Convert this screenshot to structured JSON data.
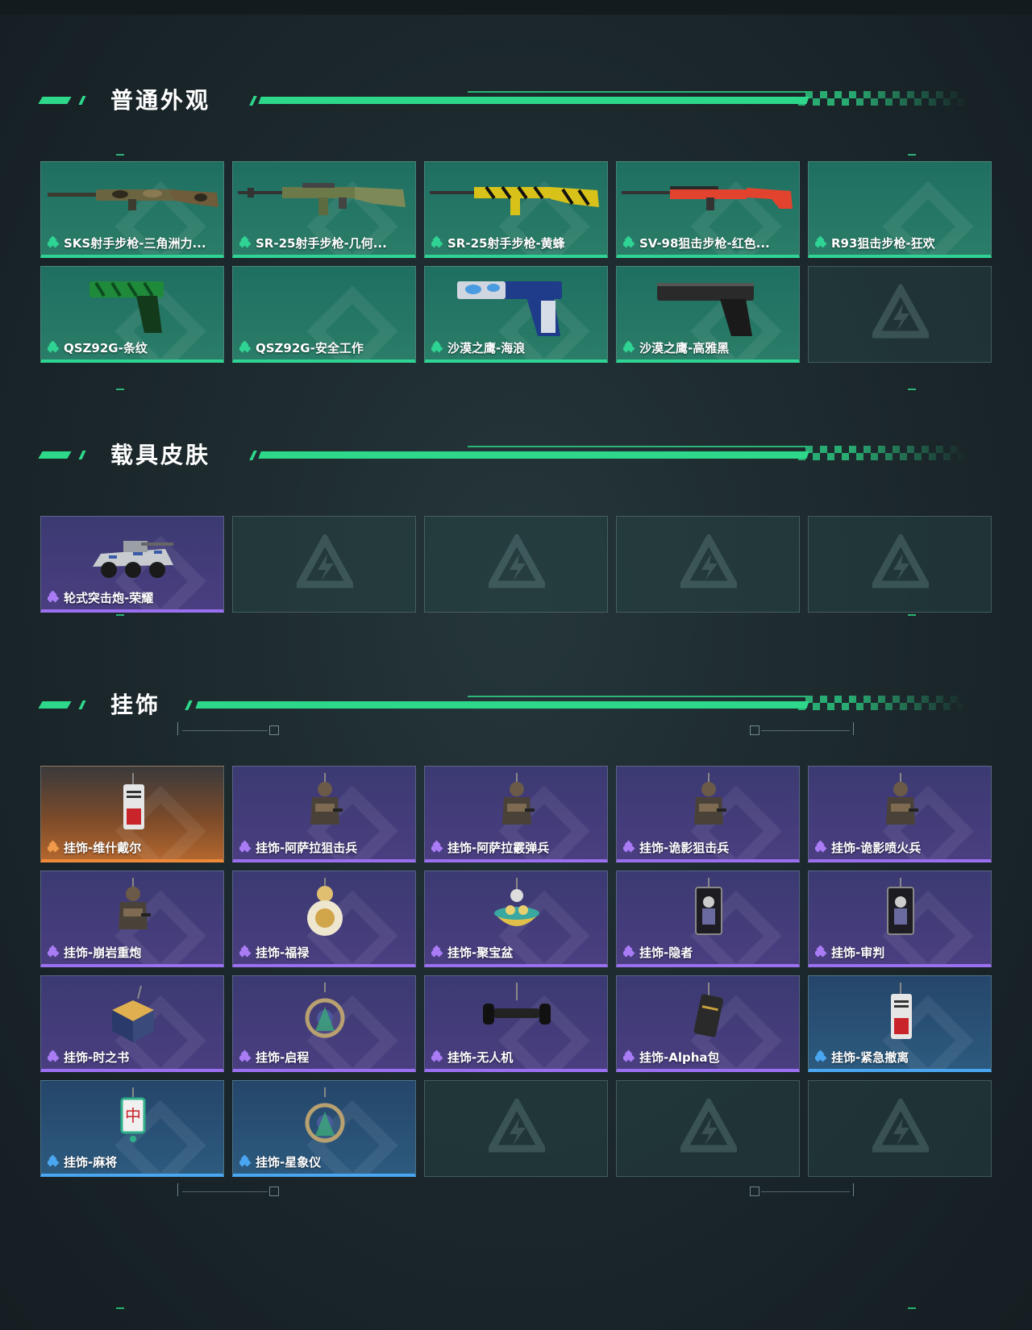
{
  "sections": [
    {
      "title": "普通外观",
      "items": [
        {
          "label": "SKS射手步枪-三角洲力...",
          "rarity": "green",
          "icon": "rifle-camo-icon"
        },
        {
          "label": "SR-25射手步枪-几何...",
          "rarity": "green",
          "icon": "rifle-geometric-icon"
        },
        {
          "label": "SR-25射手步枪-黄蜂",
          "rarity": "green",
          "icon": "rifle-yellow-icon"
        },
        {
          "label": "SV-98狙击步枪-红色...",
          "rarity": "green",
          "icon": "sniper-red-icon"
        },
        {
          "label": "R93狙击步枪-狂欢",
          "rarity": "green",
          "icon": "none"
        },
        {
          "label": "QSZ92G-条纹",
          "rarity": "green",
          "icon": "pistol-green-icon"
        },
        {
          "label": "QSZ92G-安全工作",
          "rarity": "green",
          "icon": "none"
        },
        {
          "label": "沙漠之鹰-海浪",
          "rarity": "green",
          "icon": "pistol-blue-icon"
        },
        {
          "label": "沙漠之鹰-高雅黑",
          "rarity": "green",
          "icon": "pistol-black-icon"
        },
        {
          "label": "",
          "rarity": "empty",
          "icon": "none"
        }
      ]
    },
    {
      "title": "载具皮肤",
      "items": [
        {
          "label": "轮式突击炮-荣耀",
          "rarity": "purple",
          "icon": "armored-vehicle-icon"
        },
        {
          "label": "",
          "rarity": "empty",
          "icon": "none"
        },
        {
          "label": "",
          "rarity": "empty",
          "icon": "none"
        },
        {
          "label": "",
          "rarity": "empty",
          "icon": "none"
        },
        {
          "label": "",
          "rarity": "empty",
          "icon": "none"
        }
      ]
    },
    {
      "title": "挂饰",
      "items": [
        {
          "label": "挂饰-维什戴尔",
          "rarity": "orange",
          "icon": "charm-tag-icon"
        },
        {
          "label": "挂饰-阿萨拉狙击兵",
          "rarity": "purple",
          "icon": "charm-figure-icon"
        },
        {
          "label": "挂饰-阿萨拉霰弹兵",
          "rarity": "purple",
          "icon": "charm-figure-icon"
        },
        {
          "label": "挂饰-诡影狙击兵",
          "rarity": "purple",
          "icon": "charm-figure-icon"
        },
        {
          "label": "挂饰-诡影喷火兵",
          "rarity": "purple",
          "icon": "charm-figure-icon"
        },
        {
          "label": "挂饰-崩岩重炮",
          "rarity": "purple",
          "icon": "charm-figure-icon"
        },
        {
          "label": "挂饰-福禄",
          "rarity": "purple",
          "icon": "charm-gourd-icon"
        },
        {
          "label": "挂饰-聚宝盆",
          "rarity": "purple",
          "icon": "charm-bowl-icon"
        },
        {
          "label": "挂饰-隐者",
          "rarity": "purple",
          "icon": "charm-card-icon"
        },
        {
          "label": "挂饰-审判",
          "rarity": "purple",
          "icon": "charm-card-icon"
        },
        {
          "label": "挂饰-时之书",
          "rarity": "purple",
          "icon": "charm-book-icon"
        },
        {
          "label": "挂饰-启程",
          "rarity": "purple",
          "icon": "charm-ring-icon"
        },
        {
          "label": "挂饰-无人机",
          "rarity": "purple",
          "icon": "charm-drone-icon"
        },
        {
          "label": "挂饰-Alpha包",
          "rarity": "purple",
          "icon": "charm-bag-icon"
        },
        {
          "label": "挂饰-紧急撤离",
          "rarity": "blue",
          "icon": "charm-tag-icon"
        },
        {
          "label": "挂饰-麻将",
          "rarity": "blue",
          "icon": "charm-mahjong-icon"
        },
        {
          "label": "挂饰-星象仪",
          "rarity": "blue",
          "icon": "charm-ring-icon"
        },
        {
          "label": "",
          "rarity": "empty",
          "icon": "none"
        },
        {
          "label": "",
          "rarity": "empty",
          "icon": "none"
        },
        {
          "label": "",
          "rarity": "empty",
          "icon": "none"
        }
      ]
    }
  ],
  "colors": {
    "accent": "#2ed88a",
    "green": "#2fd394",
    "purple": "#9a6ff0",
    "orange": "#ee8a3a",
    "blue": "#4aa6f0"
  }
}
